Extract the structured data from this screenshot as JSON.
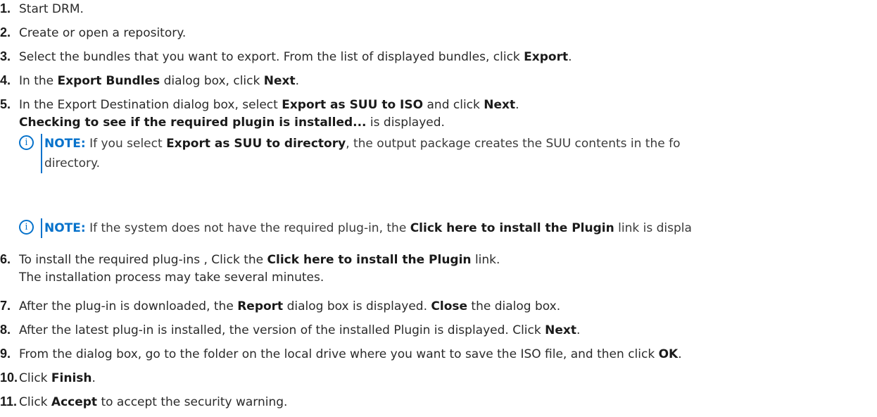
{
  "steps": [
    {
      "num": "1.",
      "parts": [
        {
          "t": "Start DRM."
        }
      ]
    },
    {
      "num": "2.",
      "parts": [
        {
          "t": "Create or open a repository."
        }
      ]
    },
    {
      "num": "3.",
      "parts": [
        {
          "t": "Select the bundles that you want to export. From the list of displayed bundles, click "
        },
        {
          "b": "Export"
        },
        {
          "t": "."
        }
      ]
    },
    {
      "num": "4.",
      "parts": [
        {
          "t": "In the "
        },
        {
          "b": "Export Bundles"
        },
        {
          "t": " dialog box, click "
        },
        {
          "b": "Next"
        },
        {
          "t": "."
        }
      ]
    },
    {
      "num": "5.",
      "parts": [
        {
          "t": "In the Export Destination dialog box, select "
        },
        {
          "b": "Export as SUU to ISO"
        },
        {
          "t": " and click "
        },
        {
          "b": "Next"
        },
        {
          "t": "."
        }
      ]
    },
    {
      "num": "6.",
      "parts": [
        {
          "t": "To install the required plug-ins , Click the "
        },
        {
          "b": "Click here to install the Plugin"
        },
        {
          "t": " link."
        }
      ]
    },
    {
      "num": "7.",
      "parts": [
        {
          "t": "After the plug-in is downloaded, the "
        },
        {
          "b": "Report"
        },
        {
          "t": " dialog box is displayed. "
        },
        {
          "b": "Close"
        },
        {
          "t": " the dialog box."
        }
      ]
    },
    {
      "num": "8.",
      "parts": [
        {
          "t": "After the latest plug-in is installed, the version of the installed Plugin is displayed. Click "
        },
        {
          "b": "Next"
        },
        {
          "t": "."
        }
      ]
    },
    {
      "num": "9.",
      "parts": [
        {
          "t": "From the dialog box, go to the folder on the local drive where you want to save the ISO file, and then click "
        },
        {
          "b": "OK"
        },
        {
          "t": "."
        }
      ]
    },
    {
      "num": "10.",
      "parts": [
        {
          "t": "Click "
        },
        {
          "b": "Finish"
        },
        {
          "t": "."
        }
      ]
    },
    {
      "num": "11.",
      "parts": [
        {
          "t": "Click "
        },
        {
          "b": "Accept"
        },
        {
          "t": " to accept the security warning."
        }
      ]
    }
  ],
  "step5_sub": [
    {
      "b": "Checking to see if the required plugin is installed..."
    },
    {
      "t": " is displayed."
    }
  ],
  "step6_sub": [
    {
      "t": "The installation process may take several minutes."
    }
  ],
  "note1": {
    "label": "NOTE:",
    "line1": [
      {
        "t": " If you select "
      },
      {
        "b": "Export as SUU to directory"
      },
      {
        "t": ", the output package creates the SUU contents in the fo"
      }
    ],
    "line2": "directory."
  },
  "note2": {
    "label": "NOTE:",
    "line1": [
      {
        "t": " If the system does not have the required plug-in, the "
      },
      {
        "b": "Click here to install the Plugin"
      },
      {
        "t": " link is displa"
      }
    ]
  },
  "colors": {
    "accent": "#0672cb",
    "text": "#2a2a2a"
  },
  "icons": {
    "note": "info-circle-icon"
  }
}
